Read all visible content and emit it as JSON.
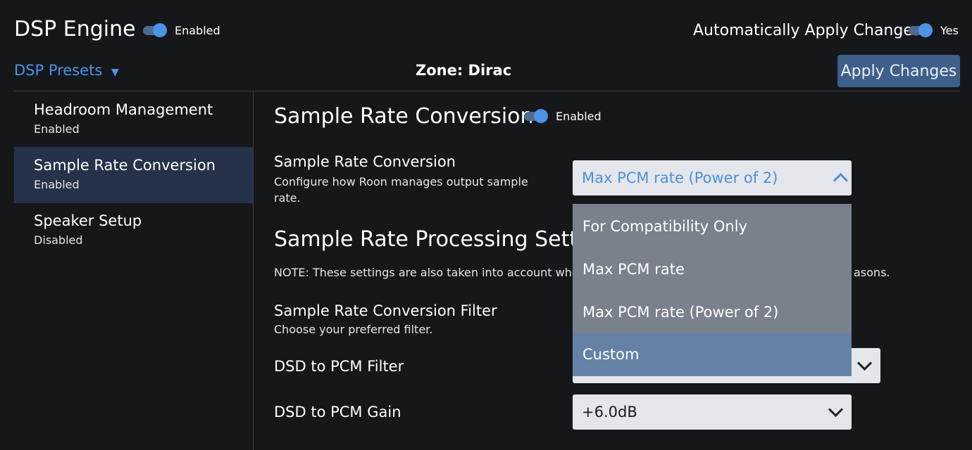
{
  "header": {
    "title": "DSP Engine",
    "enabled_label": "Enabled",
    "auto_apply_label": "Automatically Apply Changes",
    "auto_apply_value": "Yes",
    "presets_label": "DSP Presets",
    "zone_label": "Zone: Dirac",
    "apply_button": "Apply Changes"
  },
  "sidebar": {
    "items": [
      {
        "title": "Headroom Management",
        "status": "Enabled"
      },
      {
        "title": "Sample Rate Conversion",
        "status": "Enabled"
      },
      {
        "title": "Speaker Setup",
        "status": "Disabled"
      }
    ]
  },
  "main": {
    "section_title": "Sample Rate Conversion",
    "section_enabled": "Enabled",
    "src_label": "Sample Rate Conversion",
    "src_desc": "Configure how Roon manages output sample rate.",
    "src_selected": "Max PCM rate (Power of 2)",
    "processing_title": "Sample Rate Processing Settings",
    "note_start": "NOTE: These settings are also taken into account whe",
    "note_end": "asons.",
    "filter_label": "Sample Rate Conversion Filter",
    "filter_desc": "Choose your preferred filter.",
    "dsd_filter_label": "DSD to PCM Filter",
    "dsd_gain_label": "DSD to PCM Gain",
    "dsd_gain_value": "+6.0dB"
  },
  "dropdown": {
    "options": [
      "For Compatibility Only",
      "Max PCM rate",
      "Max PCM rate (Power of 2)",
      "Custom"
    ],
    "highlighted": "Custom"
  },
  "colors": {
    "background": "#16171b",
    "accent": "#4c93e6",
    "sidebar_active": "#253249",
    "button": "#3e5f88",
    "dropdown_bg": "#7a818b",
    "dropdown_highlight": "#6582a6"
  }
}
